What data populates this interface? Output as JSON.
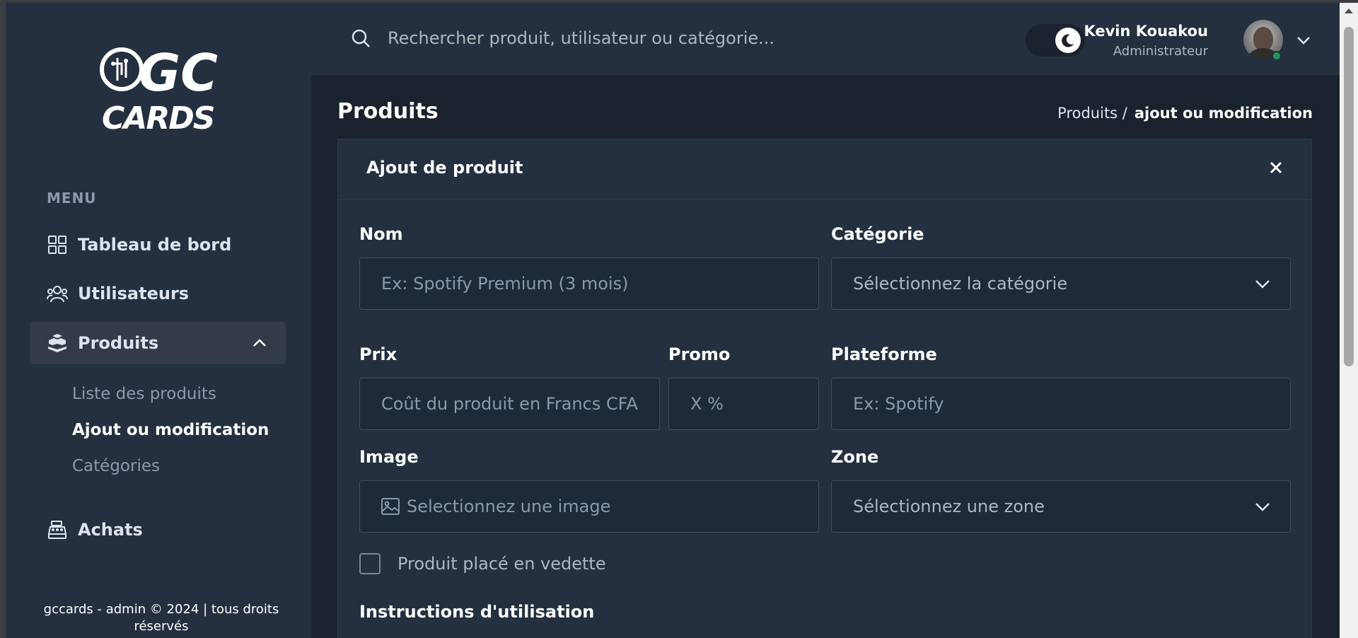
{
  "sidebar": {
    "logo_text": "GC CARDS",
    "menu_heading": "MENU",
    "nav": {
      "dashboard": "Tableau de bord",
      "users": "Utilisateurs",
      "products": "Produits",
      "purchases": "Achats"
    },
    "products_sub": {
      "list": "Liste des produits",
      "add_edit": "Ajout ou modification",
      "categories": "Catégories"
    },
    "footer": "gccards - admin © 2024 | tous droits réservés"
  },
  "header": {
    "search_placeholder": "Rechercher produit, utilisateur ou catégorie...",
    "user_name": "Kevin Kouakou",
    "user_role": "Administrateur"
  },
  "page": {
    "title": "Produits",
    "breadcrumb_parent": "Produits /",
    "breadcrumb_current": "ajout ou modification"
  },
  "form": {
    "title": "Ajout de produit",
    "name_label": "Nom",
    "name_placeholder": "Ex: Spotify Premium (3 mois)",
    "category_label": "Catégorie",
    "category_value": "Sélectionnez la catégorie",
    "price_label": "Prix",
    "price_placeholder": "Coût du produit en Francs CFA",
    "promo_label": "Promo",
    "promo_placeholder": "X %",
    "platform_label": "Plateforme",
    "platform_placeholder": "Ex: Spotify",
    "image_label": "Image",
    "image_placeholder": "Selectionnez une image",
    "zone_label": "Zone",
    "zone_value": "Sélectionnez une zone",
    "featured_label": "Produit placé en vedette",
    "instructions_label": "Instructions d'utilisation"
  },
  "colors": {
    "sidebar_bg": "#24303f",
    "page_bg": "#1a222d",
    "input_bg": "#1d2a39",
    "online": "#219653"
  }
}
